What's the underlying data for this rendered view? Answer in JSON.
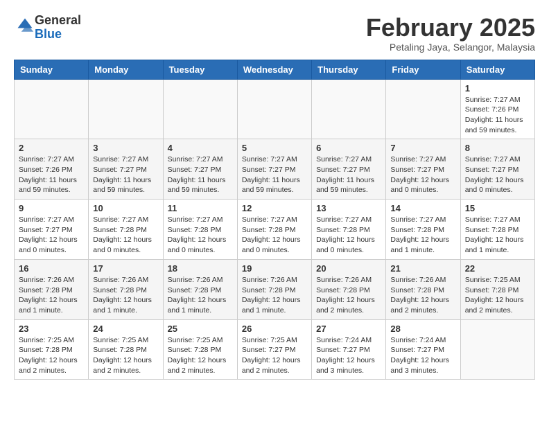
{
  "header": {
    "logo_general": "General",
    "logo_blue": "Blue",
    "month_title": "February 2025",
    "subtitle": "Petaling Jaya, Selangor, Malaysia"
  },
  "days_of_week": [
    "Sunday",
    "Monday",
    "Tuesday",
    "Wednesday",
    "Thursday",
    "Friday",
    "Saturday"
  ],
  "weeks": [
    {
      "days": [
        {
          "number": "",
          "info": ""
        },
        {
          "number": "",
          "info": ""
        },
        {
          "number": "",
          "info": ""
        },
        {
          "number": "",
          "info": ""
        },
        {
          "number": "",
          "info": ""
        },
        {
          "number": "",
          "info": ""
        },
        {
          "number": "1",
          "info": "Sunrise: 7:27 AM\nSunset: 7:26 PM\nDaylight: 11 hours and 59 minutes."
        }
      ]
    },
    {
      "days": [
        {
          "number": "2",
          "info": "Sunrise: 7:27 AM\nSunset: 7:26 PM\nDaylight: 11 hours and 59 minutes."
        },
        {
          "number": "3",
          "info": "Sunrise: 7:27 AM\nSunset: 7:27 PM\nDaylight: 11 hours and 59 minutes."
        },
        {
          "number": "4",
          "info": "Sunrise: 7:27 AM\nSunset: 7:27 PM\nDaylight: 11 hours and 59 minutes."
        },
        {
          "number": "5",
          "info": "Sunrise: 7:27 AM\nSunset: 7:27 PM\nDaylight: 11 hours and 59 minutes."
        },
        {
          "number": "6",
          "info": "Sunrise: 7:27 AM\nSunset: 7:27 PM\nDaylight: 11 hours and 59 minutes."
        },
        {
          "number": "7",
          "info": "Sunrise: 7:27 AM\nSunset: 7:27 PM\nDaylight: 12 hours and 0 minutes."
        },
        {
          "number": "8",
          "info": "Sunrise: 7:27 AM\nSunset: 7:27 PM\nDaylight: 12 hours and 0 minutes."
        }
      ]
    },
    {
      "days": [
        {
          "number": "9",
          "info": "Sunrise: 7:27 AM\nSunset: 7:27 PM\nDaylight: 12 hours and 0 minutes."
        },
        {
          "number": "10",
          "info": "Sunrise: 7:27 AM\nSunset: 7:28 PM\nDaylight: 12 hours and 0 minutes."
        },
        {
          "number": "11",
          "info": "Sunrise: 7:27 AM\nSunset: 7:28 PM\nDaylight: 12 hours and 0 minutes."
        },
        {
          "number": "12",
          "info": "Sunrise: 7:27 AM\nSunset: 7:28 PM\nDaylight: 12 hours and 0 minutes."
        },
        {
          "number": "13",
          "info": "Sunrise: 7:27 AM\nSunset: 7:28 PM\nDaylight: 12 hours and 0 minutes."
        },
        {
          "number": "14",
          "info": "Sunrise: 7:27 AM\nSunset: 7:28 PM\nDaylight: 12 hours and 1 minute."
        },
        {
          "number": "15",
          "info": "Sunrise: 7:27 AM\nSunset: 7:28 PM\nDaylight: 12 hours and 1 minute."
        }
      ]
    },
    {
      "days": [
        {
          "number": "16",
          "info": "Sunrise: 7:26 AM\nSunset: 7:28 PM\nDaylight: 12 hours and 1 minute."
        },
        {
          "number": "17",
          "info": "Sunrise: 7:26 AM\nSunset: 7:28 PM\nDaylight: 12 hours and 1 minute."
        },
        {
          "number": "18",
          "info": "Sunrise: 7:26 AM\nSunset: 7:28 PM\nDaylight: 12 hours and 1 minute."
        },
        {
          "number": "19",
          "info": "Sunrise: 7:26 AM\nSunset: 7:28 PM\nDaylight: 12 hours and 1 minute."
        },
        {
          "number": "20",
          "info": "Sunrise: 7:26 AM\nSunset: 7:28 PM\nDaylight: 12 hours and 2 minutes."
        },
        {
          "number": "21",
          "info": "Sunrise: 7:26 AM\nSunset: 7:28 PM\nDaylight: 12 hours and 2 minutes."
        },
        {
          "number": "22",
          "info": "Sunrise: 7:25 AM\nSunset: 7:28 PM\nDaylight: 12 hours and 2 minutes."
        }
      ]
    },
    {
      "days": [
        {
          "number": "23",
          "info": "Sunrise: 7:25 AM\nSunset: 7:28 PM\nDaylight: 12 hours and 2 minutes."
        },
        {
          "number": "24",
          "info": "Sunrise: 7:25 AM\nSunset: 7:28 PM\nDaylight: 12 hours and 2 minutes."
        },
        {
          "number": "25",
          "info": "Sunrise: 7:25 AM\nSunset: 7:28 PM\nDaylight: 12 hours and 2 minutes."
        },
        {
          "number": "26",
          "info": "Sunrise: 7:25 AM\nSunset: 7:27 PM\nDaylight: 12 hours and 2 minutes."
        },
        {
          "number": "27",
          "info": "Sunrise: 7:24 AM\nSunset: 7:27 PM\nDaylight: 12 hours and 3 minutes."
        },
        {
          "number": "28",
          "info": "Sunrise: 7:24 AM\nSunset: 7:27 PM\nDaylight: 12 hours and 3 minutes."
        },
        {
          "number": "",
          "info": ""
        }
      ]
    }
  ]
}
